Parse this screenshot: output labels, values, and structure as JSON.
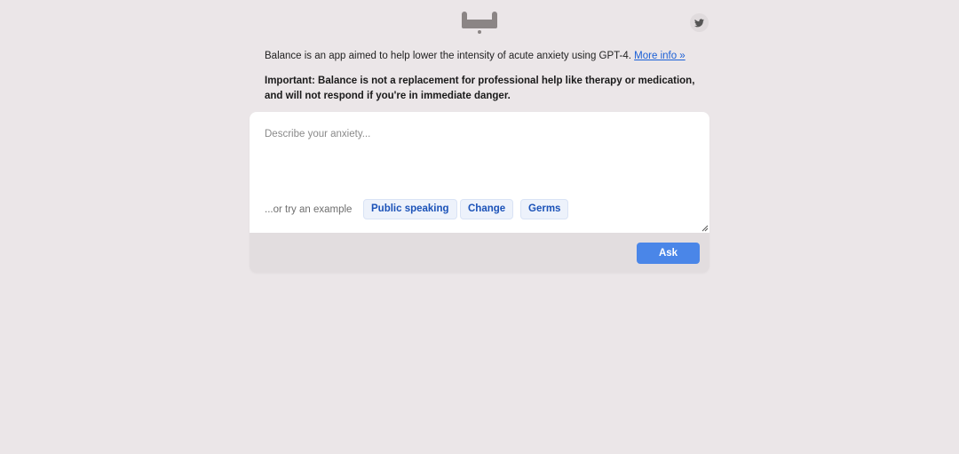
{
  "header": {
    "logo_icon": "balance-logo-icon",
    "twitter_icon": "twitter-bird-icon"
  },
  "intro": {
    "text": "Balance is an app aimed to help lower the intensity of acute anxiety using GPT-4.",
    "more_info_label": "More info »"
  },
  "important": {
    "text": "Important: Balance is not a replacement for professional help like therapy or medication, and will not respond if you're in immediate danger."
  },
  "prompt": {
    "placeholder": "Describe your anxiety...",
    "value": ""
  },
  "examples": {
    "label": "...or try an example",
    "items": [
      "Public speaking",
      "Change",
      "Germs"
    ]
  },
  "actions": {
    "ask_label": "Ask"
  },
  "colors": {
    "background": "#ebe6e8",
    "accent": "#4a86e8",
    "link": "#1a5fd6",
    "chip_text": "#1b52b8"
  }
}
